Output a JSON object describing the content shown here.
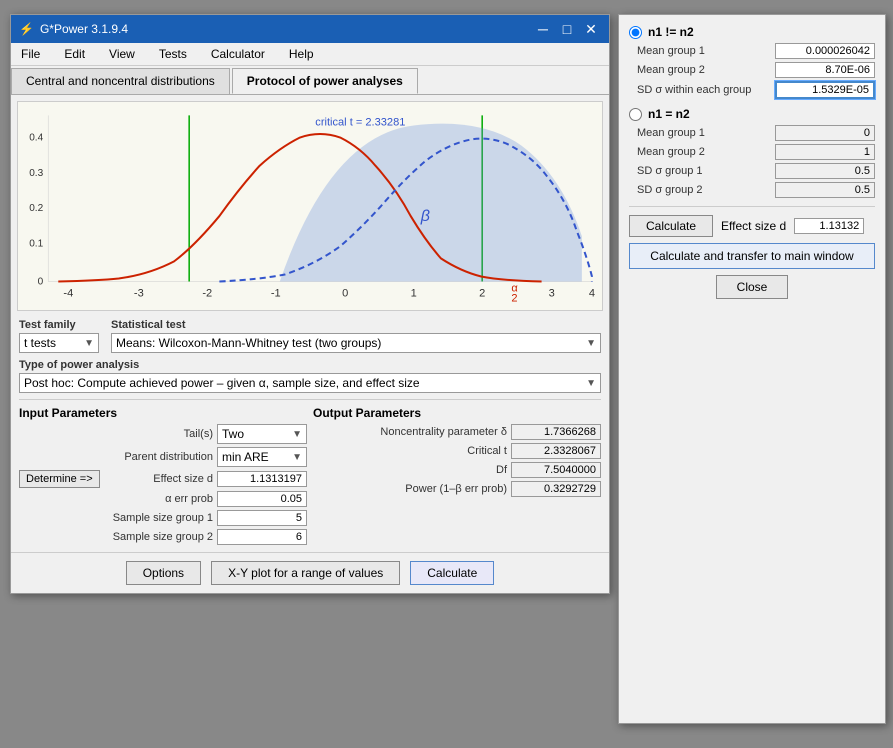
{
  "app": {
    "title": "G*Power 3.1.9.4",
    "icon": "gpower-icon"
  },
  "menu": {
    "items": [
      "File",
      "Edit",
      "View",
      "Tests",
      "Calculator",
      "Help"
    ]
  },
  "tabs": [
    {
      "label": "Central and noncentral distributions",
      "active": false
    },
    {
      "label": "Protocol of power analyses",
      "active": true
    }
  ],
  "chart": {
    "critical_t_label": "critical t = 2.33281",
    "beta_label": "β",
    "alpha_label": "α\n2"
  },
  "test_family": {
    "label": "Test family",
    "value": "t tests"
  },
  "statistical_test": {
    "label": "Statistical test",
    "value": "Means: Wilcoxon-Mann-Whitney test (two groups)"
  },
  "power_analysis": {
    "label": "Type of power analysis",
    "value": "Post hoc: Compute achieved power – given α, sample size, and effect size"
  },
  "input_params": {
    "title": "Input Parameters",
    "rows": [
      {
        "label": "Tail(s)",
        "value": "Two",
        "is_combo": true
      },
      {
        "label": "Parent distribution",
        "value": "min ARE",
        "is_combo": true
      },
      {
        "label": "Effect size d",
        "value": "1.1313197"
      },
      {
        "label": "α err prob",
        "value": "0.05"
      },
      {
        "label": "Sample size group 1",
        "value": "5"
      },
      {
        "label": "Sample size group 2",
        "value": "6"
      }
    ],
    "determine_btn": "Determine =>"
  },
  "output_params": {
    "title": "Output Parameters",
    "rows": [
      {
        "label": "Noncentrality parameter δ",
        "value": "1.7366268"
      },
      {
        "label": "Critical t",
        "value": "2.3328067"
      },
      {
        "label": "Df",
        "value": "7.5040000"
      },
      {
        "label": "Power (1–β err prob)",
        "value": "0.3292729"
      }
    ]
  },
  "bottom_buttons": {
    "options": "Options",
    "xy_plot": "X-Y plot for a range of values",
    "calculate": "Calculate"
  },
  "right_panel": {
    "option1": {
      "label": "n1 != n2",
      "checked": true,
      "fields": [
        {
          "label": "Mean group 1",
          "value": "0.000026042",
          "highlighted": false
        },
        {
          "label": "Mean group 2",
          "value": "8.70E-06",
          "highlighted": false
        },
        {
          "label": "SD σ within each group",
          "value": "1.5329E-05",
          "highlighted": true
        }
      ]
    },
    "option2": {
      "label": "n1 = n2",
      "checked": false,
      "fields": [
        {
          "label": "Mean group 1",
          "value": "0",
          "highlighted": false
        },
        {
          "label": "Mean group 2",
          "value": "1",
          "highlighted": false
        },
        {
          "label": "SD σ group 1",
          "value": "0.5",
          "highlighted": false
        },
        {
          "label": "SD σ group 2",
          "value": "0.5",
          "highlighted": false
        }
      ]
    },
    "calculate_btn": "Calculate",
    "effect_size_label": "Effect size d",
    "effect_size_value": "1.13132",
    "transfer_btn": "Calculate and transfer to main window",
    "close_btn": "Close"
  }
}
